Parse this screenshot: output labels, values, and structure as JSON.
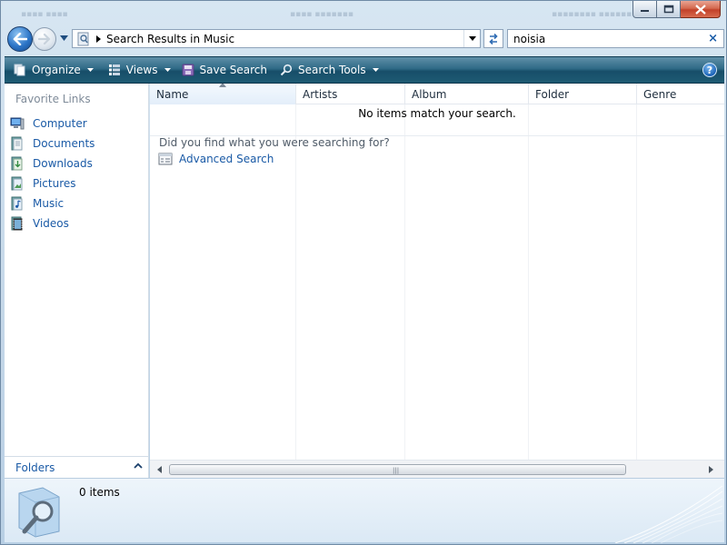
{
  "window": {
    "caption": {
      "minimize_icon": "minimize-icon",
      "maximize_icon": "maximize-icon",
      "close_icon": "close-icon"
    }
  },
  "navigation": {
    "back_icon": "back-arrow-icon",
    "forward_icon": "forward-arrow-icon",
    "address_path": "Search Results in Music",
    "refresh_icon": "refresh-icon"
  },
  "search": {
    "value": "noisia",
    "clear_glyph": "×"
  },
  "toolbar": {
    "organize": "Organize",
    "views": "Views",
    "save_search": "Save Search",
    "search_tools": "Search Tools",
    "help": "?"
  },
  "sidebar": {
    "title": "Favorite Links",
    "items": [
      {
        "label": "Computer",
        "icon": "computer-icon"
      },
      {
        "label": "Documents",
        "icon": "documents-icon"
      },
      {
        "label": "Downloads",
        "icon": "downloads-icon"
      },
      {
        "label": "Pictures",
        "icon": "pictures-icon"
      },
      {
        "label": "Music",
        "icon": "music-icon"
      },
      {
        "label": "Videos",
        "icon": "videos-icon"
      }
    ],
    "folders_label": "Folders"
  },
  "content": {
    "columns": [
      "Name",
      "Artists",
      "Album",
      "Folder",
      "Genre"
    ],
    "sorted_column": "Name",
    "empty_message": "No items match your search.",
    "suggest_title": "Did you find what you were searching for?",
    "advanced_search_label": "Advanced Search"
  },
  "details": {
    "item_count": "0 items"
  },
  "colors": {
    "link": "#1a5aa6",
    "command_bar": "#1e5a73",
    "close_button": "#c2412a"
  }
}
